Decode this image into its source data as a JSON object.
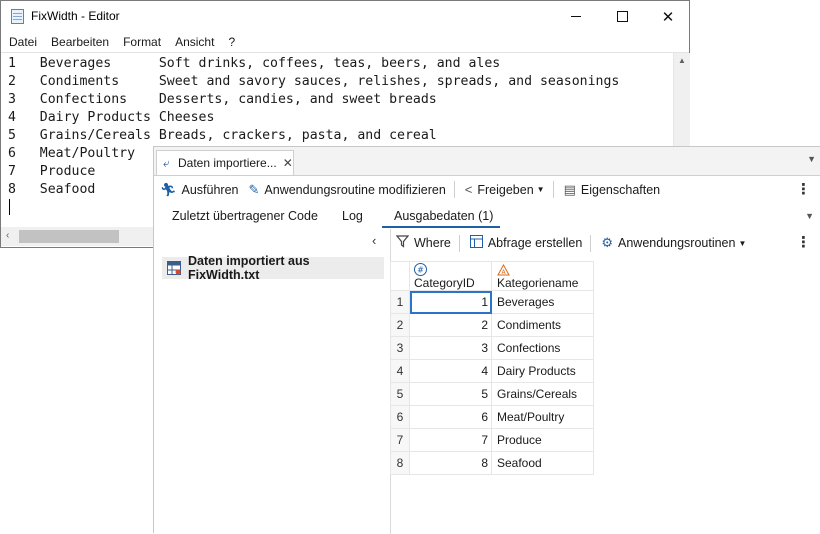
{
  "notepad": {
    "title": "FixWidth - Editor",
    "menu": [
      "Datei",
      "Bearbeiten",
      "Format",
      "Ansicht",
      "?"
    ],
    "lines": [
      "1   Beverages      Soft drinks, coffees, teas, beers, and ales",
      "2   Condiments     Sweet and savory sauces, relishes, spreads, and seasonings",
      "3   Confections    Desserts, candies, and sweet breads",
      "4   Dairy Products Cheeses",
      "5   Grains/Cereals Breads, crackers, pasta, and cereal",
      "6   Meat/Poultry",
      "7   Produce",
      "8   Seafood"
    ]
  },
  "sas": {
    "tab_label": "Daten importiere...",
    "toolbar": {
      "run": "Ausführen",
      "modify": "Anwendungsroutine modifizieren",
      "share": "Freigeben",
      "properties": "Eigenschaften"
    },
    "subtabs": [
      "Zuletzt übertragener Code",
      "Log",
      "Ausgabedaten (1)"
    ],
    "tree_item": "Daten importiert aus FixWidth.txt",
    "right_toolbar": {
      "where": "Where",
      "query": "Abfrage erstellen",
      "routines": "Anwendungsroutinen"
    },
    "columns": [
      "CategoryID",
      "Kategoriename"
    ],
    "rows": [
      {
        "n": "1",
        "id": "1",
        "name": "Beverages"
      },
      {
        "n": "2",
        "id": "2",
        "name": "Condiments"
      },
      {
        "n": "3",
        "id": "3",
        "name": "Confections"
      },
      {
        "n": "4",
        "id": "4",
        "name": "Dairy Products"
      },
      {
        "n": "5",
        "id": "5",
        "name": "Grains/Cereals"
      },
      {
        "n": "6",
        "id": "6",
        "name": "Meat/Poultry"
      },
      {
        "n": "7",
        "id": "7",
        "name": "Produce"
      },
      {
        "n": "8",
        "id": "8",
        "name": "Seafood"
      }
    ]
  }
}
